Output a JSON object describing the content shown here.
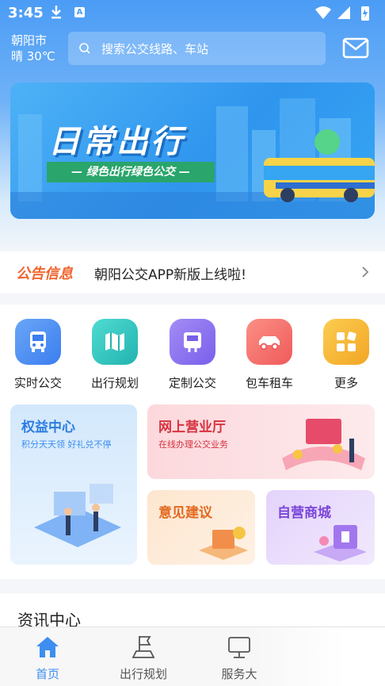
{
  "status": {
    "time": "3:45",
    "notif_icon": "download-icon",
    "app_icon_letter": "A"
  },
  "header": {
    "city": "朝阳市",
    "weather": "晴 30℃",
    "search_placeholder": "搜索公交线路、车站",
    "mail_icon": "mail-icon"
  },
  "banner": {
    "title": "日常出行",
    "subtitle": "— 绿色出行绿色公交 —"
  },
  "notice": {
    "label": "公告信息",
    "text": "朝阳公交APP新版上线啦!"
  },
  "quick": [
    {
      "label": "实时公交",
      "icon": "bus-icon",
      "color": "#4a8df3"
    },
    {
      "label": "出行规划",
      "icon": "map-icon",
      "color": "#2fc6c0"
    },
    {
      "label": "定制公交",
      "icon": "bus-stop-icon",
      "color": "#8a73f0"
    },
    {
      "label": "包车租车",
      "icon": "car-icon",
      "color": "#f4706d"
    },
    {
      "label": "更多",
      "icon": "grid-icon",
      "color": "#f6b733"
    }
  ],
  "cards": {
    "rights": {
      "title": "权益中心",
      "subtitle": "积分天天领 好礼兑不停"
    },
    "online": {
      "title": "网上营业厅",
      "subtitle": "在线办理公交业务"
    },
    "feedback": {
      "title": "意见建议"
    },
    "mall": {
      "title": "自营商城"
    }
  },
  "news": {
    "title": "资讯中心"
  },
  "tabs": [
    {
      "label": "首页",
      "icon": "home-icon",
      "active": true
    },
    {
      "label": "出行规划",
      "icon": "route-icon",
      "active": false
    },
    {
      "label": "服务大",
      "icon": "monitor-icon",
      "active": false
    }
  ],
  "colors": {
    "primary": "#3d8ef0",
    "notice": "#f0652f"
  }
}
